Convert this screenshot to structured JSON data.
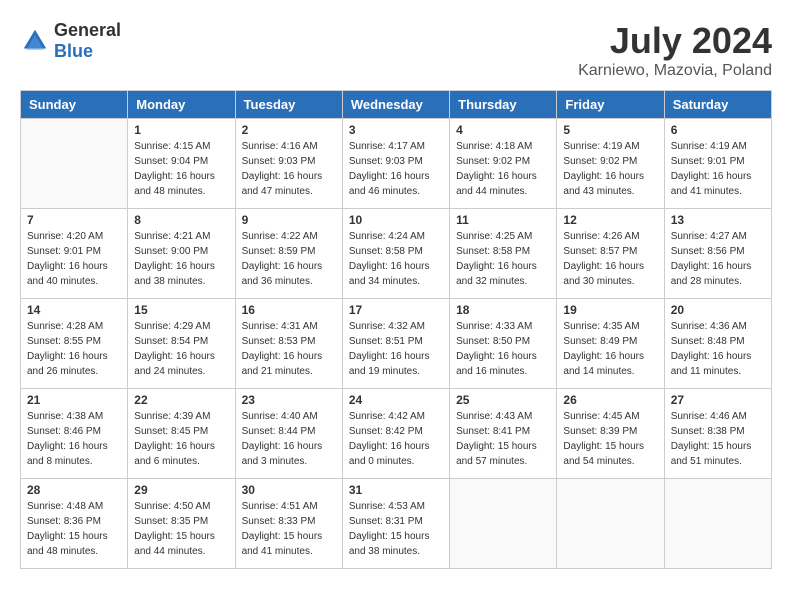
{
  "header": {
    "logo_general": "General",
    "logo_blue": "Blue",
    "month_year": "July 2024",
    "location": "Karniewo, Mazovia, Poland"
  },
  "days_of_week": [
    "Sunday",
    "Monday",
    "Tuesday",
    "Wednesday",
    "Thursday",
    "Friday",
    "Saturday"
  ],
  "weeks": [
    [
      {
        "day": "",
        "info": ""
      },
      {
        "day": "1",
        "info": "Sunrise: 4:15 AM\nSunset: 9:04 PM\nDaylight: 16 hours\nand 48 minutes."
      },
      {
        "day": "2",
        "info": "Sunrise: 4:16 AM\nSunset: 9:03 PM\nDaylight: 16 hours\nand 47 minutes."
      },
      {
        "day": "3",
        "info": "Sunrise: 4:17 AM\nSunset: 9:03 PM\nDaylight: 16 hours\nand 46 minutes."
      },
      {
        "day": "4",
        "info": "Sunrise: 4:18 AM\nSunset: 9:02 PM\nDaylight: 16 hours\nand 44 minutes."
      },
      {
        "day": "5",
        "info": "Sunrise: 4:19 AM\nSunset: 9:02 PM\nDaylight: 16 hours\nand 43 minutes."
      },
      {
        "day": "6",
        "info": "Sunrise: 4:19 AM\nSunset: 9:01 PM\nDaylight: 16 hours\nand 41 minutes."
      }
    ],
    [
      {
        "day": "7",
        "info": "Sunrise: 4:20 AM\nSunset: 9:01 PM\nDaylight: 16 hours\nand 40 minutes."
      },
      {
        "day": "8",
        "info": "Sunrise: 4:21 AM\nSunset: 9:00 PM\nDaylight: 16 hours\nand 38 minutes."
      },
      {
        "day": "9",
        "info": "Sunrise: 4:22 AM\nSunset: 8:59 PM\nDaylight: 16 hours\nand 36 minutes."
      },
      {
        "day": "10",
        "info": "Sunrise: 4:24 AM\nSunset: 8:58 PM\nDaylight: 16 hours\nand 34 minutes."
      },
      {
        "day": "11",
        "info": "Sunrise: 4:25 AM\nSunset: 8:58 PM\nDaylight: 16 hours\nand 32 minutes."
      },
      {
        "day": "12",
        "info": "Sunrise: 4:26 AM\nSunset: 8:57 PM\nDaylight: 16 hours\nand 30 minutes."
      },
      {
        "day": "13",
        "info": "Sunrise: 4:27 AM\nSunset: 8:56 PM\nDaylight: 16 hours\nand 28 minutes."
      }
    ],
    [
      {
        "day": "14",
        "info": "Sunrise: 4:28 AM\nSunset: 8:55 PM\nDaylight: 16 hours\nand 26 minutes."
      },
      {
        "day": "15",
        "info": "Sunrise: 4:29 AM\nSunset: 8:54 PM\nDaylight: 16 hours\nand 24 minutes."
      },
      {
        "day": "16",
        "info": "Sunrise: 4:31 AM\nSunset: 8:53 PM\nDaylight: 16 hours\nand 21 minutes."
      },
      {
        "day": "17",
        "info": "Sunrise: 4:32 AM\nSunset: 8:51 PM\nDaylight: 16 hours\nand 19 minutes."
      },
      {
        "day": "18",
        "info": "Sunrise: 4:33 AM\nSunset: 8:50 PM\nDaylight: 16 hours\nand 16 minutes."
      },
      {
        "day": "19",
        "info": "Sunrise: 4:35 AM\nSunset: 8:49 PM\nDaylight: 16 hours\nand 14 minutes."
      },
      {
        "day": "20",
        "info": "Sunrise: 4:36 AM\nSunset: 8:48 PM\nDaylight: 16 hours\nand 11 minutes."
      }
    ],
    [
      {
        "day": "21",
        "info": "Sunrise: 4:38 AM\nSunset: 8:46 PM\nDaylight: 16 hours\nand 8 minutes."
      },
      {
        "day": "22",
        "info": "Sunrise: 4:39 AM\nSunset: 8:45 PM\nDaylight: 16 hours\nand 6 minutes."
      },
      {
        "day": "23",
        "info": "Sunrise: 4:40 AM\nSunset: 8:44 PM\nDaylight: 16 hours\nand 3 minutes."
      },
      {
        "day": "24",
        "info": "Sunrise: 4:42 AM\nSunset: 8:42 PM\nDaylight: 16 hours\nand 0 minutes."
      },
      {
        "day": "25",
        "info": "Sunrise: 4:43 AM\nSunset: 8:41 PM\nDaylight: 15 hours\nand 57 minutes."
      },
      {
        "day": "26",
        "info": "Sunrise: 4:45 AM\nSunset: 8:39 PM\nDaylight: 15 hours\nand 54 minutes."
      },
      {
        "day": "27",
        "info": "Sunrise: 4:46 AM\nSunset: 8:38 PM\nDaylight: 15 hours\nand 51 minutes."
      }
    ],
    [
      {
        "day": "28",
        "info": "Sunrise: 4:48 AM\nSunset: 8:36 PM\nDaylight: 15 hours\nand 48 minutes."
      },
      {
        "day": "29",
        "info": "Sunrise: 4:50 AM\nSunset: 8:35 PM\nDaylight: 15 hours\nand 44 minutes."
      },
      {
        "day": "30",
        "info": "Sunrise: 4:51 AM\nSunset: 8:33 PM\nDaylight: 15 hours\nand 41 minutes."
      },
      {
        "day": "31",
        "info": "Sunrise: 4:53 AM\nSunset: 8:31 PM\nDaylight: 15 hours\nand 38 minutes."
      },
      {
        "day": "",
        "info": ""
      },
      {
        "day": "",
        "info": ""
      },
      {
        "day": "",
        "info": ""
      }
    ]
  ]
}
